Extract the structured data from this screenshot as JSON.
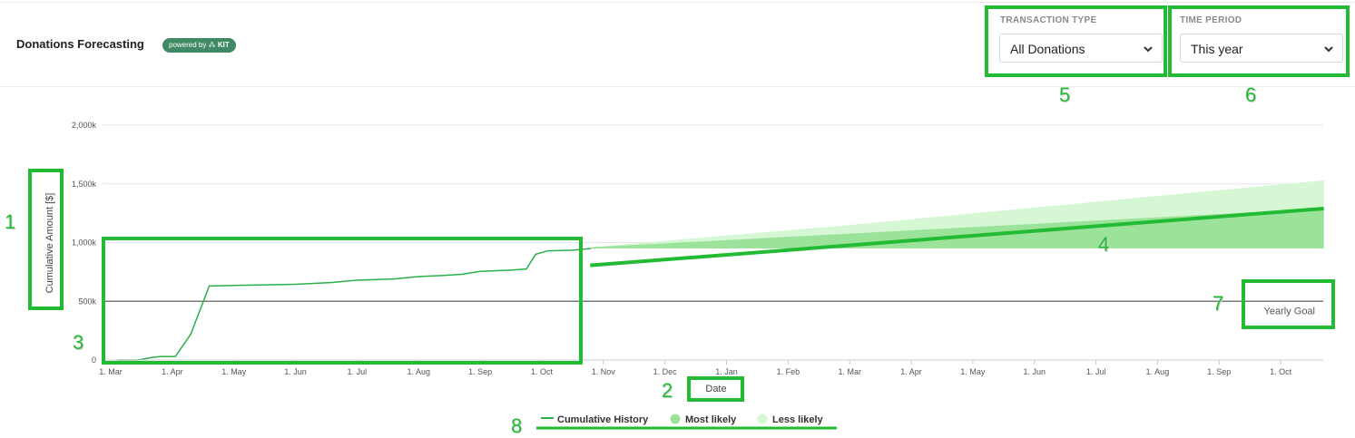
{
  "header": {
    "title": "Donations Forecasting",
    "badge_prefix": "powered by",
    "badge_brand": "KIT"
  },
  "filters": {
    "transaction_type": {
      "label": "TRANSACTION TYPE",
      "value": "All Donations"
    },
    "time_period": {
      "label": "TIME PERIOD",
      "value": "This year"
    }
  },
  "annotations": [
    "1",
    "2",
    "3",
    "4",
    "5",
    "6",
    "7",
    "8"
  ],
  "colors": {
    "history": "#2ab04a",
    "most_likely": "#9be39b",
    "less_likely": "#d6f7d4",
    "goal_line": "#7a7a7a",
    "annotation": "#22bb33"
  },
  "chart_data": {
    "type": "area",
    "ylabel": "Cumulative Amount [$]",
    "xlabel": "Date",
    "y_ticks": [
      "0",
      "500k",
      "1,000k",
      "1,500k",
      "2,000k"
    ],
    "ylim": [
      0,
      2000000
    ],
    "x_ticks": [
      "1. Mar",
      "1. Apr",
      "1. May",
      "1. Jun",
      "1. Jul",
      "1. Aug",
      "1. Sep",
      "1. Oct",
      "1. Nov",
      "1. Dec",
      "1. Jan",
      "1. Feb",
      "1. Mar",
      "1. Apr",
      "1. May",
      "1. Jun",
      "1. Jul",
      "1. Aug",
      "1. Sep",
      "1. Oct"
    ],
    "x_range_months": [
      0,
      19.85
    ],
    "grid": true,
    "legend_position": "bottom-center",
    "goal": {
      "label": "Yearly Goal",
      "value": 500000
    },
    "series": [
      {
        "name": "Cumulative History",
        "kind": "line",
        "x": [
          0.1,
          0.45,
          0.65,
          0.8,
          0.95,
          1.05,
          1.3,
          1.6,
          2.0,
          3.0,
          3.6,
          4.0,
          4.6,
          5.0,
          5.4,
          5.7,
          6.0,
          6.5,
          6.75,
          6.9,
          7.1,
          7.5,
          7.8
        ],
        "y": [
          0,
          0,
          20000,
          30000,
          30000,
          30000,
          220000,
          630000,
          635000,
          645000,
          660000,
          680000,
          690000,
          710000,
          720000,
          730000,
          755000,
          765000,
          775000,
          900000,
          930000,
          935000,
          950000
        ]
      },
      {
        "name": "Most likely",
        "kind": "band",
        "x": [
          7.8,
          19.7
        ],
        "upper": [
          960000,
          1290000
        ],
        "lower": [
          950000,
          950000
        ]
      },
      {
        "name": "Less likely",
        "kind": "band",
        "x": [
          7.8,
          12.0,
          19.7
        ],
        "upper": [
          960000,
          1150000,
          1530000
        ],
        "lower": [
          950000,
          950000,
          950000
        ]
      }
    ]
  }
}
